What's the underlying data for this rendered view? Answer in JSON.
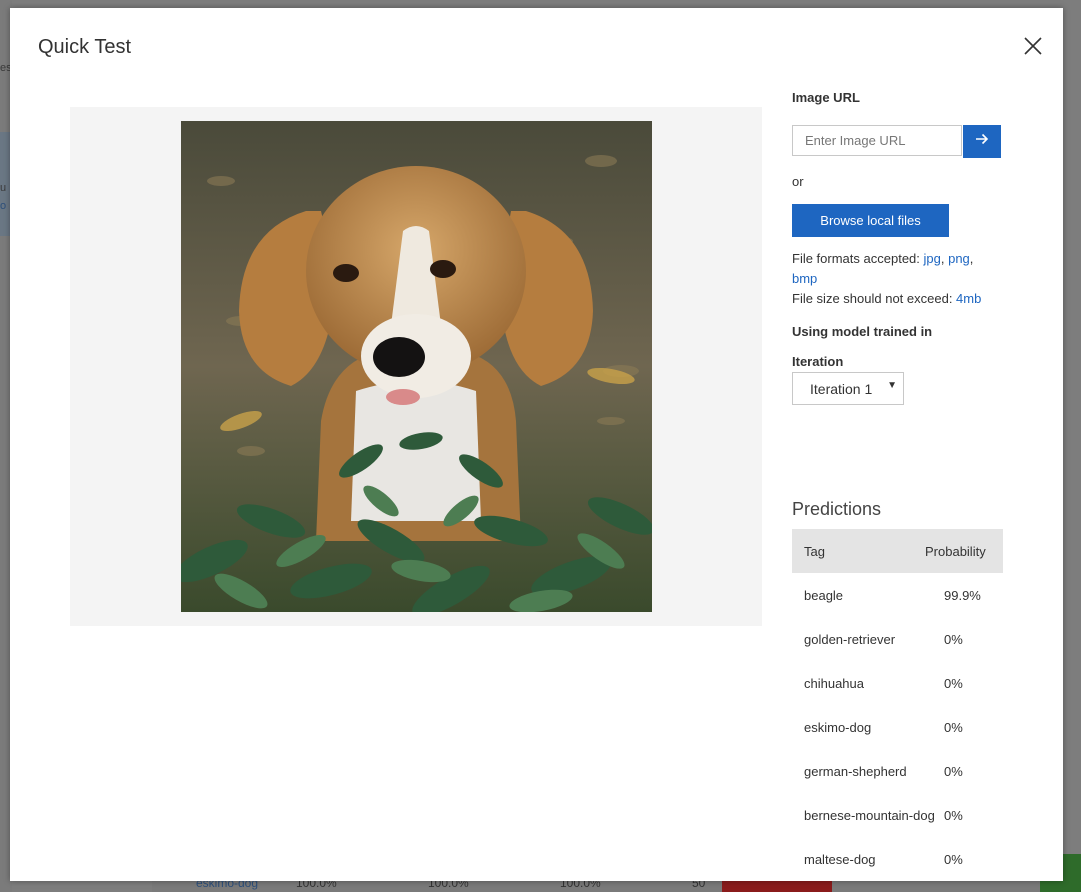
{
  "background": {
    "edge_text_1": "es",
    "edge_text_2": "u",
    "edge_text_3": "o",
    "row": [
      "eskimo-dog",
      "100.0%",
      "100.0%",
      "100.0%",
      "50"
    ]
  },
  "modal": {
    "title": "Quick Test",
    "close_icon": "close-icon"
  },
  "image_url": {
    "label": "Image URL",
    "placeholder": "Enter Image URL",
    "go_icon": "arrow-right-icon"
  },
  "or_text": "or",
  "browse_label": "Browse local files",
  "file_info": {
    "formats_prefix": "File formats accepted: ",
    "formats": [
      "jpg",
      "png",
      "bmp"
    ],
    "size_prefix": "File size should not exceed: ",
    "size": "4mb"
  },
  "model": {
    "heading": "Using model trained in",
    "iteration_label": "Iteration",
    "iteration_value": "Iteration 1"
  },
  "predictions": {
    "title": "Predictions",
    "columns": [
      "Tag",
      "Probability"
    ],
    "rows": [
      {
        "tag": "beagle",
        "probability": "99.9%"
      },
      {
        "tag": "golden-retriever",
        "probability": "0%"
      },
      {
        "tag": "chihuahua",
        "probability": "0%"
      },
      {
        "tag": "eskimo-dog",
        "probability": "0%"
      },
      {
        "tag": "german-shepherd",
        "probability": "0%"
      },
      {
        "tag": "bernese-mountain-dog",
        "probability": "0%"
      },
      {
        "tag": "maltese-dog",
        "probability": "0%"
      }
    ]
  },
  "colors": {
    "accent": "#1e66c1",
    "table_header": "#e4e4e4",
    "image_panel": "#f4f4f4"
  }
}
